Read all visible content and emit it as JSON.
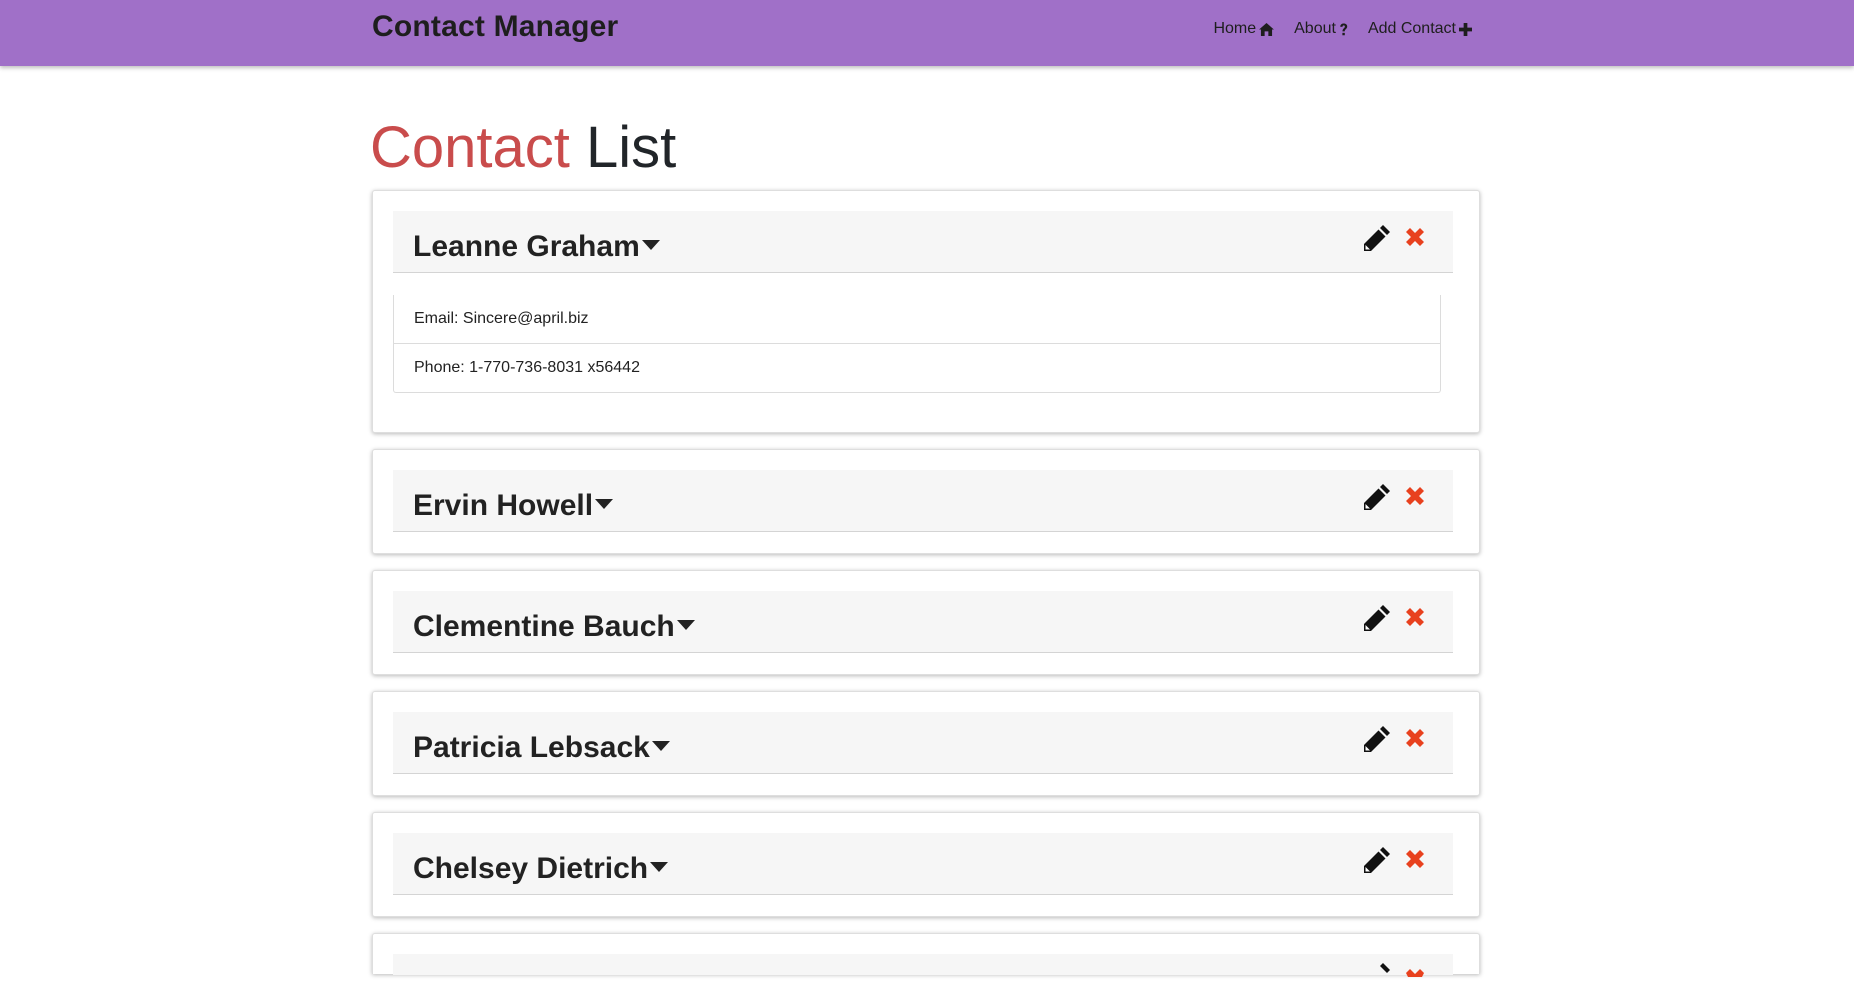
{
  "app": {
    "brand": "Contact Manager",
    "nav": [
      {
        "label": "Home",
        "icon": "home-icon"
      },
      {
        "label": "About",
        "icon": "question-icon"
      },
      {
        "label": "Add Contact",
        "icon": "plus-icon"
      }
    ],
    "colors": {
      "navbar": "#a070c8",
      "title_accent": "#c94c4c",
      "delete": "#e8411e"
    }
  },
  "page": {
    "title_part1": "Contact",
    "title_part2": "List"
  },
  "contacts": [
    {
      "name": "Leanne Graham",
      "expanded": true,
      "email": "Email: Sincere@april.biz",
      "phone": "Phone: 1-770-736-8031 x56442"
    },
    {
      "name": "Ervin Howell",
      "expanded": false
    },
    {
      "name": "Clementine Bauch",
      "expanded": false
    },
    {
      "name": "Patricia Lebsack",
      "expanded": false
    },
    {
      "name": "Chelsey Dietrich",
      "expanded": false
    },
    {
      "name": "",
      "expanded": false
    }
  ],
  "icons": {
    "expand": "caret-down-icon",
    "edit": "pencil-icon",
    "delete": "times-icon"
  }
}
